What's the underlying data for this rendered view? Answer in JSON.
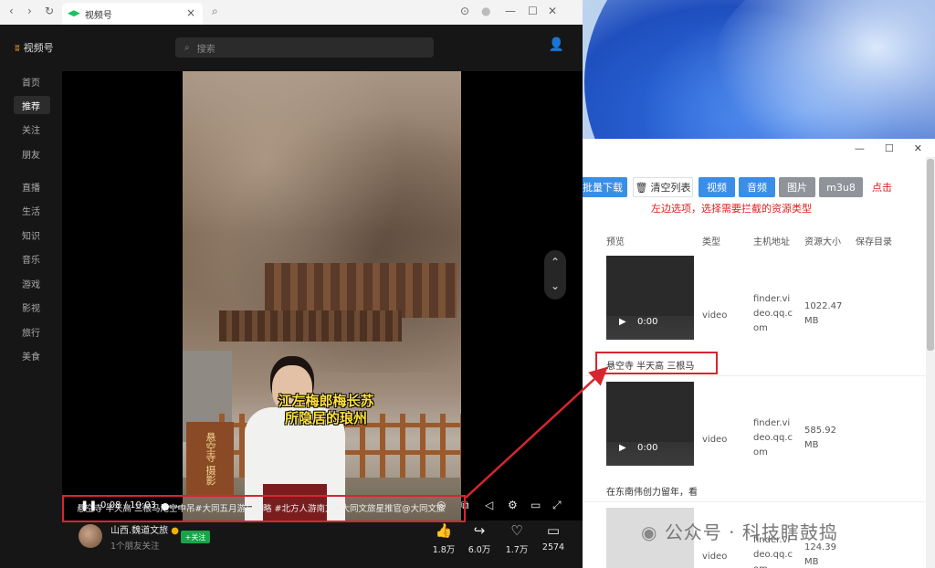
{
  "browser": {
    "tab_title": "视频号",
    "logo_text": "视频号",
    "search_placeholder": "搜索",
    "sidebar": [
      "首页",
      "推荐",
      "关注",
      "朋友",
      "直播",
      "生活",
      "知识",
      "音乐",
      "游戏",
      "影视",
      "旅行",
      "美食"
    ],
    "active_sidebar": "推荐",
    "video": {
      "subtitle_line1": "江左梅郎梅长苏",
      "subtitle_line2": "所隐居的琅州",
      "sign_text": "悬空寺 摄影",
      "time": "0:08 / 10:03",
      "progress": 0.013,
      "description": "悬空寺 半天高 三根马尾空中吊#大同五月游玩攻略 #北方人游南方#大同文旅星推官@大同文旅",
      "author": "山西.魏道文旅",
      "friends_following": "1个朋友关注",
      "follow_label": "+关注",
      "likes": "1.8万",
      "shares": "6.0万",
      "favorites": "1.7万",
      "comments": "2574"
    }
  },
  "tool": {
    "batch_download": "批量下载",
    "clear_list": "清空列表",
    "filter_buttons": [
      "视频",
      "音频",
      "图片",
      "m3u8"
    ],
    "click_hint": "点击",
    "select_hint": "左边选项，选择需要拦截的资源类型",
    "columns": [
      "预览",
      "类型",
      "主机地址",
      "资源大小",
      "保存目录"
    ],
    "rows": [
      {
        "thumb_time": "0:00",
        "type": "video",
        "host": "finder.video.qq.com",
        "size": "1022.47 MB",
        "caption": "悬空寺 半天高 三根马"
      },
      {
        "thumb_time": "0:00",
        "type": "video",
        "host": "finder.video.qq.com",
        "size": "585.92 MB",
        "caption": "在东南伟创力留年，看"
      },
      {
        "thumb_time": "",
        "type": "video",
        "host": "finder.video.qq.com",
        "size": "124.39 MB",
        "caption": ""
      }
    ]
  },
  "watermark": "公众号 · 科技瞎鼓捣",
  "colors": {
    "accent_blue": "#3a8ee6",
    "highlight_red": "#d7262e",
    "follow_green": "#19a34a",
    "logo_orange": "#f0a020"
  }
}
